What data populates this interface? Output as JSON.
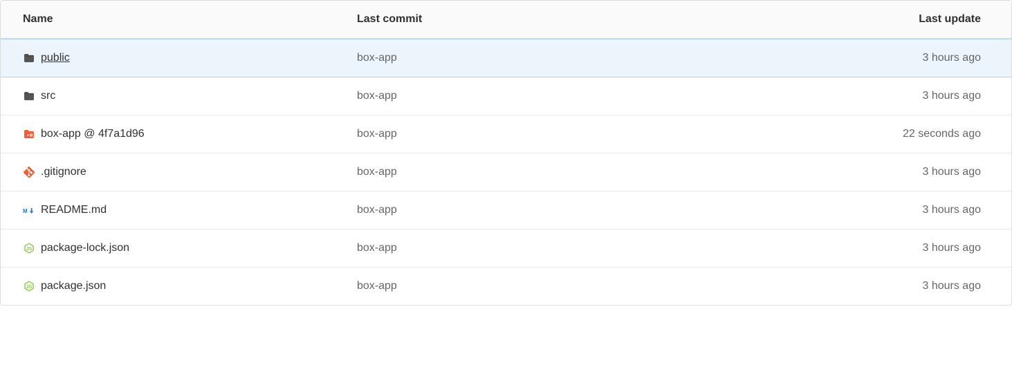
{
  "header": {
    "name": "Name",
    "lastCommit": "Last commit",
    "lastUpdate": "Last update"
  },
  "rows": [
    {
      "icon": "folder",
      "name": "public",
      "nameExtra": "",
      "underlined": true,
      "highlighted": true,
      "commit": "box-app",
      "update": "3 hours ago"
    },
    {
      "icon": "folder",
      "name": "src",
      "nameExtra": "",
      "underlined": false,
      "highlighted": false,
      "commit": "box-app",
      "update": "3 hours ago"
    },
    {
      "icon": "submodule",
      "name": "box-app @ ",
      "nameExtra": "4f7a1d96",
      "underlined": false,
      "highlighted": false,
      "commit": "box-app",
      "update": "22 seconds ago"
    },
    {
      "icon": "git",
      "name": ".gitignore",
      "nameExtra": "",
      "underlined": false,
      "highlighted": false,
      "commit": "box-app",
      "update": "3 hours ago"
    },
    {
      "icon": "markdown",
      "name": "README.md",
      "nameExtra": "",
      "underlined": false,
      "highlighted": false,
      "commit": "box-app",
      "update": "3 hours ago"
    },
    {
      "icon": "nodejs",
      "name": "package-lock.json",
      "nameExtra": "",
      "underlined": false,
      "highlighted": false,
      "commit": "box-app",
      "update": "3 hours ago"
    },
    {
      "icon": "nodejs",
      "name": "package.json",
      "nameExtra": "",
      "underlined": false,
      "highlighted": false,
      "commit": "box-app",
      "update": "3 hours ago"
    }
  ]
}
